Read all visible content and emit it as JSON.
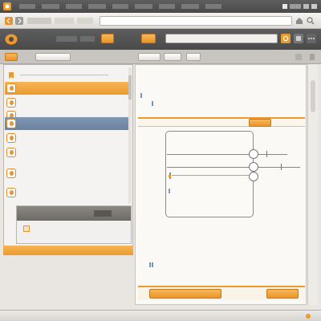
{
  "colors": {
    "accent_orange": "#ec9a2d",
    "chrome_dark": "#4f4f4f",
    "selection_blue": "#6f87a4",
    "panel_bg": "#f4f3f1"
  },
  "window": {
    "title": "",
    "menu_labels": [
      "",
      "",
      "",
      "",
      "",
      "",
      "",
      "",
      ""
    ],
    "window_controls_text": ""
  },
  "toolbar": {
    "tab_labels": [
      "",
      "",
      ""
    ],
    "address_value": "",
    "icons": [
      "back-icon",
      "forward-icon",
      "home-icon",
      "search-icon"
    ]
  },
  "app_toolbar": {
    "app_name": "",
    "menu_items": [
      "",
      "",
      "",
      ""
    ],
    "search_value": "",
    "icons": [
      "logo-icon",
      "settings-icon"
    ]
  },
  "subbar": {
    "tabs": [
      "",
      "",
      "",
      "",
      ""
    ]
  },
  "left_panel": {
    "header": "",
    "items": [
      {
        "title": "",
        "subtitle": ""
      },
      {
        "title": "",
        "subtitle": ""
      },
      {
        "title": "",
        "subtitle": ""
      },
      {
        "title": "",
        "subtitle": ""
      },
      {
        "title": "",
        "subtitle": ""
      },
      {
        "title": "",
        "subtitle": ""
      },
      {
        "title": "",
        "subtitle": ""
      },
      {
        "title": "",
        "subtitle": ""
      },
      {
        "title": "",
        "subtitle": ""
      }
    ],
    "section_header": "",
    "section_rows": [
      "",
      "",
      ""
    ],
    "footer_bar": ""
  },
  "right_panel": {
    "heading": "",
    "fields": [
      "",
      "",
      ""
    ],
    "highlight_line": "",
    "highlight_button": "",
    "diagram_labels": [
      "",
      "",
      "",
      "",
      ""
    ],
    "footer_line": "",
    "footer_sub": "",
    "bottom_buttons": [
      "",
      ""
    ]
  },
  "statusbar": {
    "left_text": "",
    "right_text": ""
  }
}
